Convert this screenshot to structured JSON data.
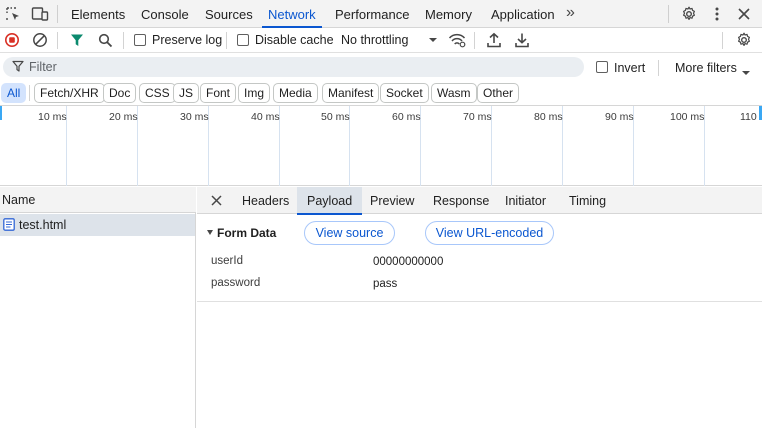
{
  "topbar": {
    "tabs": [
      {
        "label": "Elements"
      },
      {
        "label": "Console"
      },
      {
        "label": "Sources"
      },
      {
        "label": "Network"
      },
      {
        "label": "Performance"
      },
      {
        "label": "Memory"
      },
      {
        "label": "Application"
      }
    ],
    "active_tab": "Network",
    "more_tabs": "»"
  },
  "toolbar": {
    "preserve_log": "Preserve log",
    "disable_cache": "Disable cache",
    "throttling": "No throttling"
  },
  "filter": {
    "placeholder": "Filter",
    "invert": "Invert",
    "more_filters": "More filters"
  },
  "types": [
    "All",
    "Fetch/XHR",
    "Doc",
    "CSS",
    "JS",
    "Font",
    "Img",
    "Media",
    "Manifest",
    "Socket",
    "Wasm",
    "Other"
  ],
  "timeline": {
    "ticks": [
      "10 ms",
      "20 ms",
      "30 ms",
      "40 ms",
      "50 ms",
      "60 ms",
      "70 ms",
      "80 ms",
      "90 ms",
      "100 ms",
      "110"
    ]
  },
  "requests": {
    "header": "Name",
    "rows": [
      {
        "name": "test.html"
      }
    ]
  },
  "details": {
    "tabs": [
      "Headers",
      "Payload",
      "Preview",
      "Response",
      "Initiator",
      "Timing"
    ],
    "active_tab": "Payload",
    "form_data": {
      "title": "Form Data",
      "view_source": "View source",
      "view_url_encoded": "View URL-encoded",
      "fields": [
        {
          "key": "userId",
          "value": "00000000000"
        },
        {
          "key": "password",
          "value": "pass"
        }
      ]
    }
  },
  "colors": {
    "accent": "#0b57d0",
    "record_stop": "#d93025",
    "filter_icon": "#0b8a6e",
    "doc_icon": "#3367d6"
  }
}
